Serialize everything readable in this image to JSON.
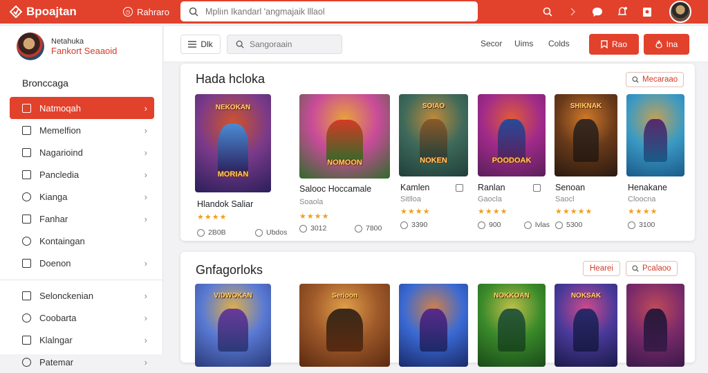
{
  "header": {
    "brand": "Bpoajtan",
    "link_label": "Rahraro",
    "search_placeholder": "Mpliın Ikandarl 'angmajaik lllaol",
    "brand_color": "#e2412c"
  },
  "sidebar": {
    "profile_name": "Netahuka",
    "profile_sub": "Fankort Seaaoid",
    "section_title": "Bronccaga",
    "items": [
      {
        "label": "Natmoqah",
        "icon": "square-icon",
        "active": true
      },
      {
        "label": "Memelfion",
        "icon": "card-icon"
      },
      {
        "label": "Nagarioind",
        "icon": "image-icon"
      },
      {
        "label": "Pancledia",
        "icon": "doc-icon"
      },
      {
        "label": "Kianga",
        "icon": "tag-icon"
      },
      {
        "label": "Fanhar",
        "icon": "folder-icon"
      },
      {
        "label": "Kontaingan",
        "icon": "circle-icon"
      },
      {
        "label": "Doenon",
        "icon": "info-icon"
      }
    ],
    "items2": [
      {
        "label": "Selonckenian",
        "icon": "grid-icon"
      },
      {
        "label": "Coobarta",
        "icon": "search-icon"
      },
      {
        "label": "Klalngar",
        "icon": "image-icon"
      },
      {
        "label": "Patemar",
        "icon": "user-icon"
      }
    ]
  },
  "subbar": {
    "filter_label": "Dlk",
    "search_placeholder": "Sangoraain",
    "links": [
      "Secor",
      "Uims",
      "Colds"
    ],
    "btn1": "Rao",
    "btn2": "Ina"
  },
  "panel1": {
    "title": "Hada hcloka",
    "button": "Mecaraao",
    "games": [
      {
        "top": "NEKOKAN",
        "cover_title": "MORIAN",
        "name": "Hlandok Saliar",
        "sub": "",
        "rating": 4,
        "stat1": "2B0B",
        "stat2": "Ubdos"
      },
      {
        "top": "",
        "cover_title": "NOMOON",
        "name": "Salooc Hoccamale",
        "sub": "Soaola",
        "rating": 4,
        "stat1": "3012",
        "stat2": "7800"
      },
      {
        "top": "SOIAO",
        "cover_title": "NOKEN",
        "name": "Kamlen",
        "sub": "Sitlloa",
        "rating": 4,
        "stat1": "3390",
        "stat2": ""
      },
      {
        "top": "",
        "cover_title": "POODOAK",
        "name": "Ranlan",
        "sub": "Gaocla",
        "rating": 4,
        "stat1": "900",
        "stat2": "lvlas"
      },
      {
        "top": "SHIKNAK",
        "cover_title": "",
        "name": "Senoan",
        "sub": "Saocl",
        "rating": 5,
        "stat1": "5300",
        "stat2": ""
      },
      {
        "top": "",
        "cover_title": "",
        "name": "Henakane",
        "sub": "Cloocna",
        "rating": 4,
        "stat1": "3100",
        "stat2": ""
      }
    ]
  },
  "panel2": {
    "title": "Gnfagorloks",
    "button1": "Hearei",
    "button2": "Pcalaoo",
    "games": [
      {
        "top": "VIDWOKAN"
      },
      {
        "top": "Serioon"
      },
      {
        "top": ""
      },
      {
        "top": "NOKKOAN"
      },
      {
        "top": "NOKSAK"
      },
      {
        "top": ""
      }
    ]
  }
}
